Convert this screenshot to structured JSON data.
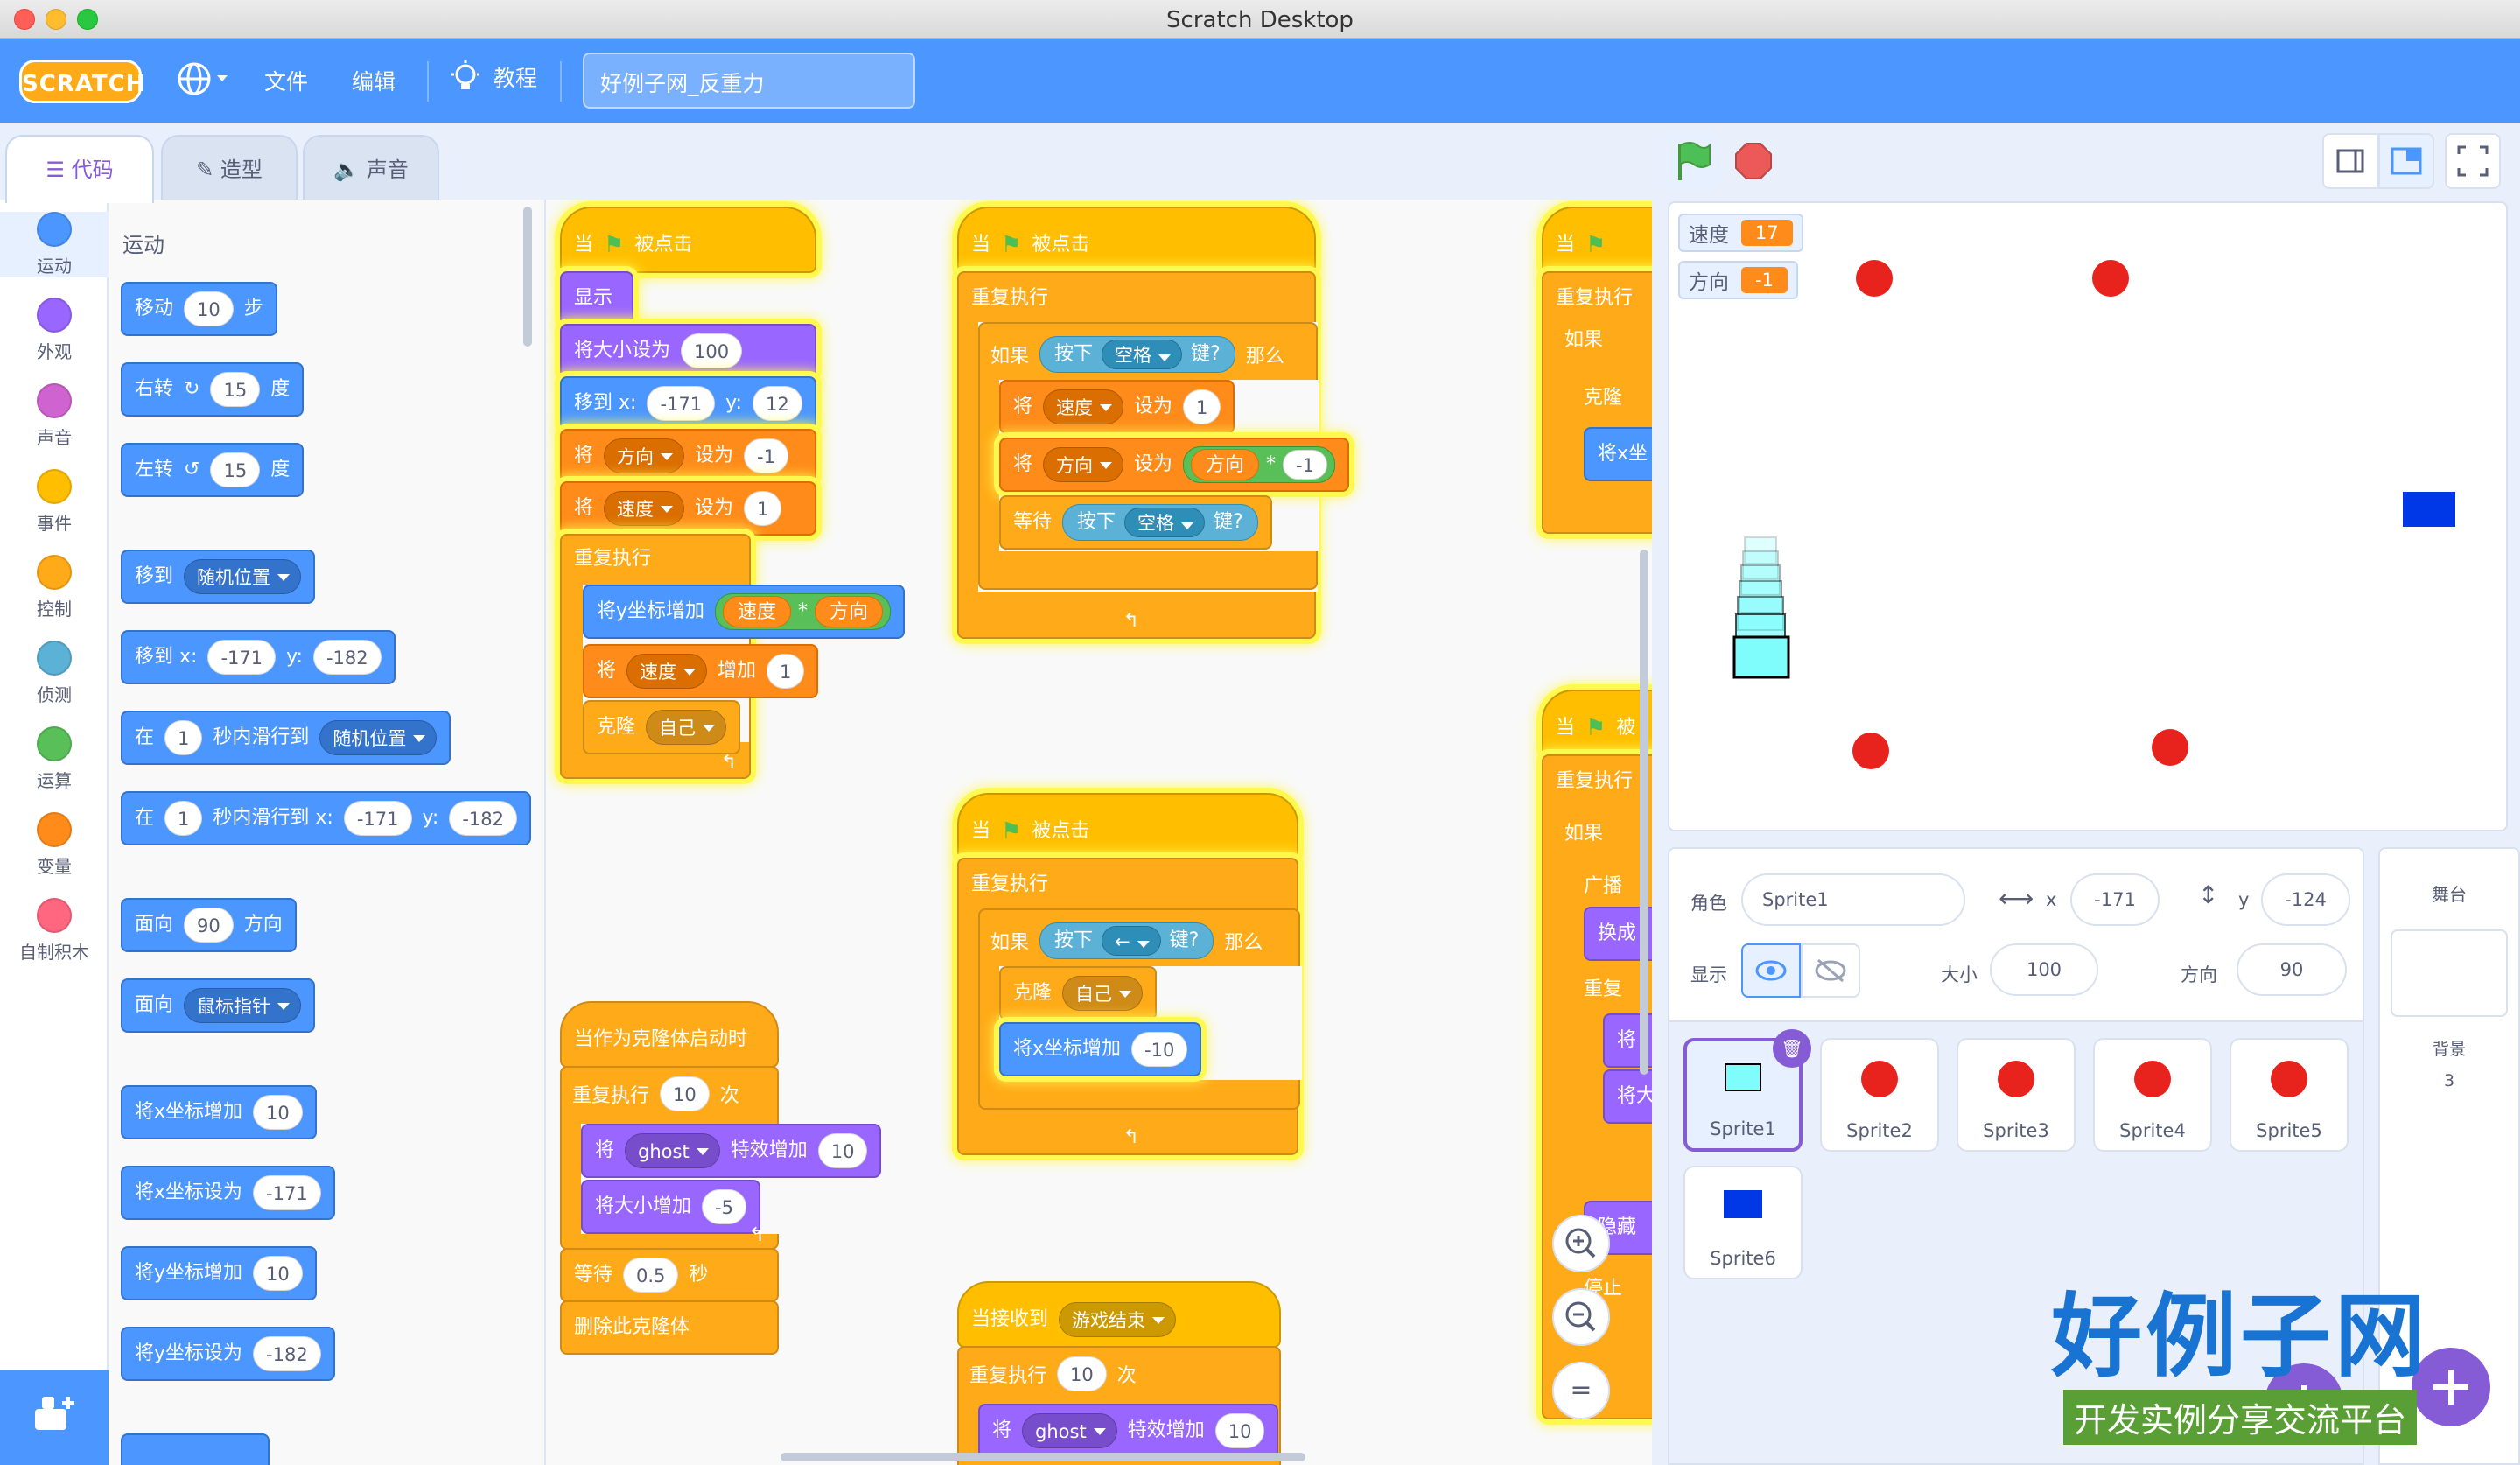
{
  "window": {
    "title": "Scratch Desktop"
  },
  "menu": {
    "logo": "SCRATCH",
    "file": "文件",
    "edit": "编辑",
    "tutorials": "教程",
    "project_title": "好例子网_反重力"
  },
  "tabs": {
    "code": "代码",
    "costumes": "造型",
    "sounds": "声音"
  },
  "categories": [
    {
      "label": "运动",
      "color": "#4c97ff"
    },
    {
      "label": "外观",
      "color": "#9966ff"
    },
    {
      "label": "声音",
      "color": "#cf63cf"
    },
    {
      "label": "事件",
      "color": "#ffbf00"
    },
    {
      "label": "控制",
      "color": "#ffab19"
    },
    {
      "label": "侦测",
      "color": "#5cb1d6"
    },
    {
      "label": "运算",
      "color": "#59c059"
    },
    {
      "label": "变量",
      "color": "#ff8c1a"
    },
    {
      "label": "自制积木",
      "color": "#ff6680"
    }
  ],
  "palette": {
    "heading": "运动",
    "move": {
      "a": "移动",
      "n": "10",
      "b": "步"
    },
    "turn_right": {
      "a": "右转",
      "n": "15",
      "b": "度"
    },
    "turn_left": {
      "a": "左转",
      "n": "15",
      "b": "度"
    },
    "goto": {
      "a": "移到",
      "d": "随机位置"
    },
    "goto_xy": {
      "a": "移到 x:",
      "x": "-171",
      "y_label": "y:",
      "y": "-182"
    },
    "glide_to": {
      "a": "在",
      "n": "1",
      "b": "秒内滑行到",
      "d": "随机位置"
    },
    "glide_xy": {
      "a": "在",
      "n": "1",
      "b": "秒内滑行到 x:",
      "x": "-171",
      "y_label": "y:",
      "y": "-182"
    },
    "point_dir": {
      "a": "面向",
      "n": "90",
      "b": "方向"
    },
    "point_towards": {
      "a": "面向",
      "d": "鼠标指针"
    },
    "change_x": {
      "a": "将x坐标增加",
      "n": "10"
    },
    "set_x": {
      "a": "将x坐标设为",
      "n": "-171"
    },
    "change_y": {
      "a": "将y坐标增加",
      "n": "10"
    },
    "set_y": {
      "a": "将y坐标设为",
      "n": "-182"
    }
  },
  "scripts": {
    "s1": {
      "hat": {
        "a": "当",
        "b": "被点击"
      },
      "show": "显示",
      "set_size": {
        "a": "将大小设为",
        "n": "100"
      },
      "goto_xy": {
        "a": "移到 x:",
        "x": "-171",
        "y_label": "y:",
        "y": "12"
      },
      "set_dir": {
        "a": "将",
        "d": "方向",
        "b": "设为",
        "n": "-1"
      },
      "set_speed": {
        "a": "将",
        "d": "速度",
        "b": "设为",
        "n": "1"
      },
      "forever": "重复执行",
      "change_y": {
        "a": "将y坐标增加",
        "r1": "速度",
        "op": "*",
        "r2": "方向"
      },
      "change_speed": {
        "a": "将",
        "d": "速度",
        "b": "增加",
        "n": "1"
      },
      "clone": {
        "a": "克隆",
        "d": "自己"
      }
    },
    "s2": {
      "hat": {
        "a": "当",
        "b": "被点击"
      },
      "forever": "重复执行",
      "if": {
        "a": "如果",
        "k1": "按下",
        "key": "空格",
        "k2": "键?",
        "then": "那么"
      },
      "set_speed": {
        "a": "将",
        "d": "速度",
        "b": "设为",
        "n": "1"
      },
      "set_dir": {
        "a": "将",
        "d": "方向",
        "b": "设为",
        "r": "方向",
        "op": "*",
        "n": "-1"
      },
      "wait": {
        "a": "等待",
        "k1": "按下",
        "key": "空格",
        "k2": "键?"
      }
    },
    "s3": {
      "hat": {
        "a": "当",
        "b": "被点击"
      },
      "forever": "重复执行",
      "if": {
        "a": "如果",
        "k1": "按下",
        "key": "←",
        "k2": "键?",
        "then": "那么"
      },
      "clone": {
        "a": "克隆",
        "d": "自己"
      },
      "change_x": {
        "a": "将x坐标增加",
        "n": "-10"
      }
    },
    "s4": {
      "hat": "当作为克隆体启动时",
      "repeat": {
        "a": "重复执行",
        "n": "10",
        "b": "次"
      },
      "effect": {
        "a": "将",
        "d": "ghost",
        "b": "特效增加",
        "n": "10"
      },
      "size": {
        "a": "将大小增加",
        "n": "-5"
      },
      "wait": {
        "a": "等待",
        "n": "0.5",
        "b": "秒"
      },
      "delete": "删除此克隆体"
    },
    "s5": {
      "hat": {
        "a": "当接收到",
        "d": "游戏结束"
      },
      "repeat": {
        "a": "重复执行",
        "n": "10",
        "b": "次"
      },
      "effect": {
        "a": "将",
        "d": "ghost",
        "b": "特效增加",
        "n": "10"
      }
    },
    "s6": {
      "hat": {
        "a": "当",
        "b": "被点击"
      },
      "forever": "重复执行",
      "if": "如果",
      "clone": "克隆",
      "set_x": "将x坐",
      "hat2": {
        "a": "当",
        "b": "被"
      },
      "forever2": "重复执行",
      "if2": "如果",
      "broadcast": "广播",
      "switch": "换成",
      "repeat": "重复",
      "set1": "将",
      "set2": "将大",
      "hide": "隐藏",
      "stop": "停止"
    }
  },
  "monitors": [
    {
      "label": "速度",
      "value": "17"
    },
    {
      "label": "方向",
      "value": "-1"
    }
  ],
  "sprite_info": {
    "sprite_label": "角色",
    "sprite_name": "Sprite1",
    "x_label": "x",
    "x": "-171",
    "y_label": "y",
    "y": "-124",
    "show_label": "显示",
    "size_label": "大小",
    "size": "100",
    "dir_label": "方向",
    "dir": "90"
  },
  "sprites": [
    {
      "name": "Sprite1"
    },
    {
      "name": "Sprite2"
    },
    {
      "name": "Sprite3"
    },
    {
      "name": "Sprite4"
    },
    {
      "name": "Sprite5"
    },
    {
      "name": "Sprite6"
    }
  ],
  "stage_pane": {
    "title": "舞台",
    "backdrops_label": "背景",
    "backdrops_count": "3"
  },
  "watermark": {
    "brand": "好例子网",
    "slogan": "开发实例分享交流平台"
  },
  "colors": {
    "menu_blue": "#4c97ff",
    "accent_purple": "#855cd6",
    "glow_yellow": "#fff84f"
  }
}
